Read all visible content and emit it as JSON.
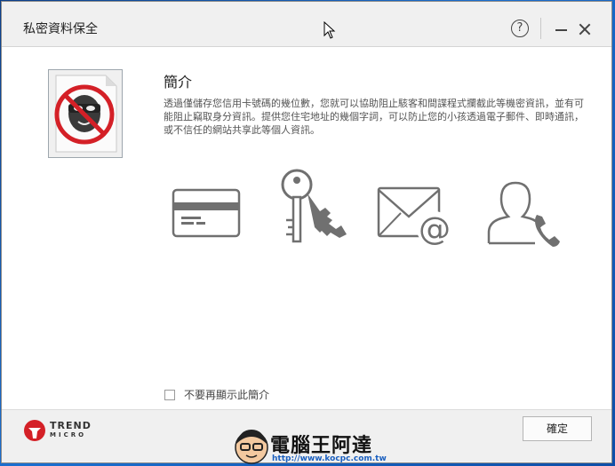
{
  "window": {
    "title": "私密資料保全",
    "help_label": "?"
  },
  "content": {
    "heading": "簡介",
    "description": "透過僅儲存您信用卡號碼的幾位數，您就可以協助阻止駭客和間諜程式攔截此等機密資訊，並有可能阻止竊取身分資訊。提供您住宅地址的幾個字詞，可以防止您的小孩透過電子郵件、即時通訊，或不信任的網站共享此等個人資訊。",
    "checkbox_label": "不要再顯示此簡介",
    "checkbox_checked": false
  },
  "features": {
    "icons": [
      "credit-card-icon",
      "keys-icon",
      "email-icon",
      "contact-phone-icon"
    ]
  },
  "footer": {
    "logo_word1": "TREND",
    "logo_word2": "MICRO",
    "ok_label": "確定"
  },
  "watermark": {
    "title": "電腦王阿達",
    "url": "http://www.kocpc.com.tw"
  },
  "colors": {
    "accent_red": "#d42027",
    "icon_gray": "#707070",
    "desktop_blue": "#1560b8"
  }
}
